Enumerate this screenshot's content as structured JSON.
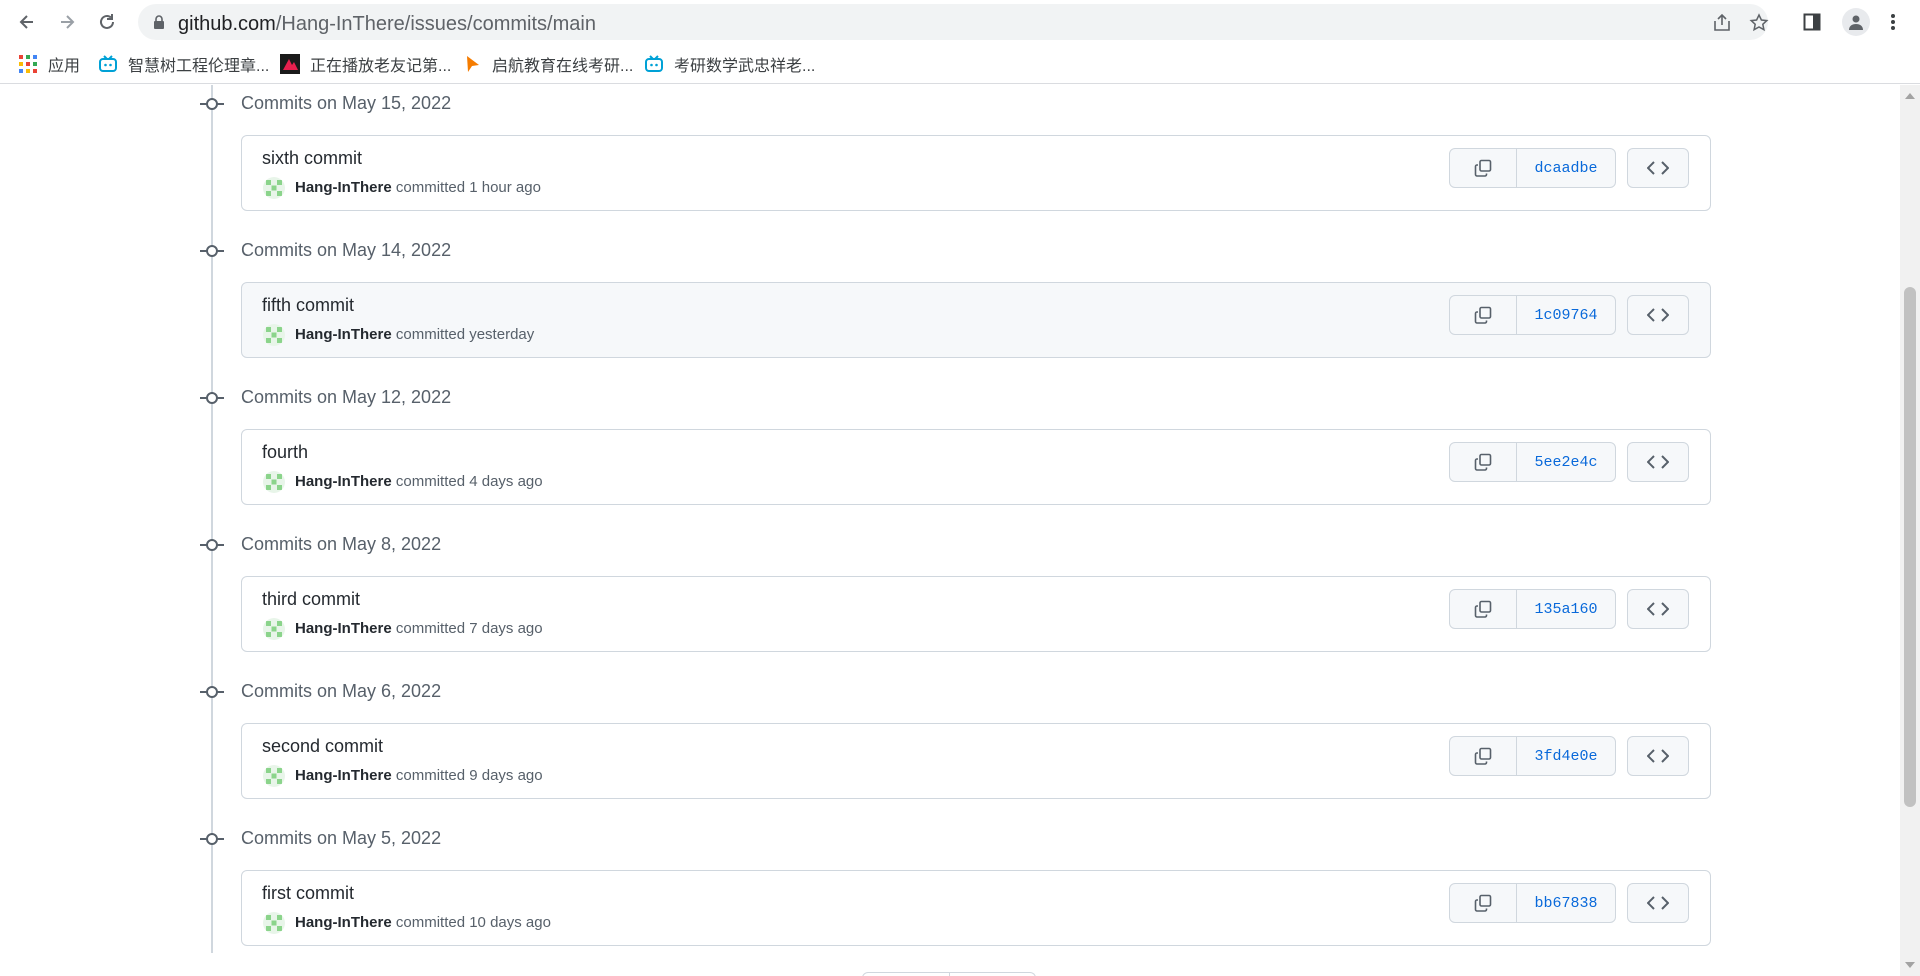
{
  "browser": {
    "url_host": "github.com",
    "url_path": "/Hang-InThere/issues/commits/main"
  },
  "bookmarks": [
    {
      "label": "应用",
      "icon": "apps-grid-icon"
    },
    {
      "label": "智慧树工程伦理章...",
      "icon": "bilibili-icon"
    },
    {
      "label": "正在播放老友记第...",
      "icon": "video-site-icon"
    },
    {
      "label": "启航教育在线考研...",
      "icon": "flag-icon"
    },
    {
      "label": "考研数学武忠祥老...",
      "icon": "bilibili-icon"
    }
  ],
  "groups": [
    {
      "title": "Commits on May 15, 2022",
      "commit": {
        "message": "sixth commit",
        "author": "Hang-InThere",
        "action": "committed",
        "time": "1 hour ago",
        "sha": "dcaadbe"
      }
    },
    {
      "title": "Commits on May 14, 2022",
      "commit": {
        "message": "fifth commit",
        "author": "Hang-InThere",
        "action": "committed",
        "time": "yesterday",
        "sha": "1c09764"
      }
    },
    {
      "title": "Commits on May 12, 2022",
      "commit": {
        "message": "fourth",
        "author": "Hang-InThere",
        "action": "committed",
        "time": "4 days ago",
        "sha": "5ee2e4c"
      }
    },
    {
      "title": "Commits on May 8, 2022",
      "commit": {
        "message": "third commit",
        "author": "Hang-InThere",
        "action": "committed",
        "time": "7 days ago",
        "sha": "135a160"
      }
    },
    {
      "title": "Commits on May 6, 2022",
      "commit": {
        "message": "second commit",
        "author": "Hang-InThere",
        "action": "committed",
        "time": "9 days ago",
        "sha": "3fd4e0e"
      }
    },
    {
      "title": "Commits on May 5, 2022",
      "commit": {
        "message": "first commit",
        "author": "Hang-InThere",
        "action": "committed",
        "time": "10 days ago",
        "sha": "bb67838"
      }
    }
  ],
  "colors": {
    "link": "#0969da",
    "muted": "#57606a",
    "border": "#d0d7de"
  }
}
